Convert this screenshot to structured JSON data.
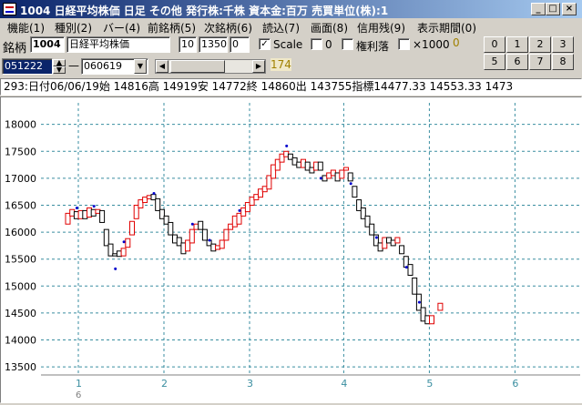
{
  "window": {
    "title": "1004 日経平均株価  日足  その他  発行株:千株  資本金:百万  売買単位(株):1",
    "min_label": "_",
    "max_label": "□",
    "close_label": "×"
  },
  "menu": [
    "機能(1)",
    "種別(2)",
    "バー(4)",
    "前銘柄(5)",
    "次銘柄(6)",
    "読込(7)",
    "画面(8)",
    "信用残(9)",
    "表示期間(0)"
  ],
  "toolbar": {
    "stock_label": "銘柄",
    "stock_code": "1004",
    "stock_name": "日経平均株価",
    "field_a": "10",
    "field_b": "1350",
    "field_c": "0",
    "scale_label": "Scale",
    "scale_checked": "✓",
    "check2_label": "0",
    "rights_label": "権利落",
    "x1000_label": "×1000",
    "x1000_value": "0",
    "numpad": [
      "0",
      "1",
      "2",
      "3",
      "5",
      "6",
      "7",
      "8"
    ]
  },
  "toolbar2": {
    "date_from": "051222",
    "dash": "—",
    "date_to": "060619",
    "count": "174"
  },
  "info": "293:日付06/06/19始 14816高 14919安 14772終 14860出 143755指標14477.33  14553.33  1473",
  "chart_data": {
    "type": "candlestick",
    "ylim": [
      13350,
      18400
    ],
    "yticks": [
      13500,
      14000,
      14500,
      15000,
      15500,
      16000,
      16500,
      17000,
      17500,
      18000
    ],
    "ytick_labels": [
      "13500",
      "14000",
      "14500",
      "15000",
      "15500",
      "16000",
      "16500",
      "17000",
      "17500",
      "18000"
    ],
    "month_labels": [
      "1",
      "2",
      "3",
      "4",
      "5",
      "6"
    ],
    "month_index": [
      0,
      20,
      40,
      62,
      82,
      102
    ],
    "year_label": "6",
    "colors": {
      "up": "#e00000",
      "down": "#000000",
      "dot": "#0000cc",
      "grid": "#3a8ea0"
    },
    "candles": [
      {
        "o": 16150,
        "c": 16350
      },
      {
        "o": 16300,
        "c": 16420
      },
      {
        "o": 16380,
        "c": 16250
      },
      {
        "o": 16250,
        "c": 16400
      },
      {
        "o": 16400,
        "c": 16250
      },
      {
        "o": 16280,
        "c": 16450
      },
      {
        "o": 16420,
        "c": 16300
      },
      {
        "o": 16350,
        "c": 16420
      },
      {
        "o": 16400,
        "c": 16180
      },
      {
        "o": 16050,
        "c": 15750
      },
      {
        "o": 15780,
        "c": 15560
      },
      {
        "o": 15600,
        "c": 15560
      },
      {
        "o": 15650,
        "c": 15550
      },
      {
        "o": 15560,
        "c": 15700
      },
      {
        "o": 15720,
        "c": 15880
      },
      {
        "o": 15950,
        "c": 16200
      },
      {
        "o": 16250,
        "c": 16500
      },
      {
        "o": 16450,
        "c": 16600
      },
      {
        "o": 16550,
        "c": 16650
      },
      {
        "o": 16620,
        "c": 16680
      },
      {
        "o": 16700,
        "c": 16600
      },
      {
        "o": 16620,
        "c": 16400
      },
      {
        "o": 16420,
        "c": 16250
      },
      {
        "o": 16300,
        "c": 16150
      },
      {
        "o": 16180,
        "c": 15950
      },
      {
        "o": 15950,
        "c": 15800
      },
      {
        "o": 15900,
        "c": 15750
      },
      {
        "o": 15800,
        "c": 15600
      },
      {
        "o": 15650,
        "c": 15850
      },
      {
        "o": 15800,
        "c": 16050
      },
      {
        "o": 16050,
        "c": 16150
      },
      {
        "o": 16200,
        "c": 16050
      },
      {
        "o": 16050,
        "c": 15850
      },
      {
        "o": 15850,
        "c": 15750
      },
      {
        "o": 15780,
        "c": 15650
      },
      {
        "o": 15680,
        "c": 15750
      },
      {
        "o": 15700,
        "c": 15850
      },
      {
        "o": 15850,
        "c": 16050
      },
      {
        "o": 16050,
        "c": 16150
      },
      {
        "o": 16100,
        "c": 16300
      },
      {
        "o": 16150,
        "c": 16350
      },
      {
        "o": 16300,
        "c": 16450
      },
      {
        "o": 16380,
        "c": 16550
      },
      {
        "o": 16500,
        "c": 16650
      },
      {
        "o": 16600,
        "c": 16700
      },
      {
        "o": 16650,
        "c": 16800
      },
      {
        "o": 16750,
        "c": 16850
      },
      {
        "o": 16800,
        "c": 17050
      },
      {
        "o": 17000,
        "c": 17250
      },
      {
        "o": 17150,
        "c": 17350
      },
      {
        "o": 17300,
        "c": 17450
      },
      {
        "o": 17400,
        "c": 17500
      },
      {
        "o": 17450,
        "c": 17350
      },
      {
        "o": 17380,
        "c": 17250
      },
      {
        "o": 17300,
        "c": 17200
      },
      {
        "o": 17200,
        "c": 17350
      },
      {
        "o": 17300,
        "c": 17150
      },
      {
        "o": 17200,
        "c": 17100
      },
      {
        "o": 17150,
        "c": 17300
      },
      {
        "o": 17300,
        "c": 17150
      },
      {
        "o": 17050,
        "c": 16950
      },
      {
        "o": 17000,
        "c": 17100
      },
      {
        "o": 17050,
        "c": 17150
      },
      {
        "o": 17100,
        "c": 16950
      },
      {
        "o": 17000,
        "c": 17150
      },
      {
        "o": 17150,
        "c": 17200
      },
      {
        "o": 17100,
        "c": 16950
      },
      {
        "o": 16850,
        "c": 16650
      },
      {
        "o": 16600,
        "c": 16400
      },
      {
        "o": 16450,
        "c": 16250
      },
      {
        "o": 16300,
        "c": 16100
      },
      {
        "o": 16150,
        "c": 15950
      },
      {
        "o": 15950,
        "c": 15750
      },
      {
        "o": 15800,
        "c": 15650
      },
      {
        "o": 15700,
        "c": 15900
      },
      {
        "o": 15900,
        "c": 15800
      },
      {
        "o": 15850,
        "c": 15750
      },
      {
        "o": 15800,
        "c": 15900
      },
      {
        "o": 15750,
        "c": 15600
      },
      {
        "o": 15550,
        "c": 15350
      },
      {
        "o": 15400,
        "c": 15200
      },
      {
        "o": 15150,
        "c": 14850
      },
      {
        "o": 14850,
        "c": 14550
      },
      {
        "o": 14600,
        "c": 14350
      },
      {
        "o": 14450,
        "c": 14300
      },
      {
        "o": 14300,
        "c": 14450
      }
    ],
    "extra_up": [
      {
        "o": 14550,
        "c": 14680
      }
    ],
    "dots": [
      {
        "i": 2,
        "v": 16450
      },
      {
        "i": 6,
        "v": 16480
      },
      {
        "i": 11,
        "v": 15320
      },
      {
        "i": 13,
        "v": 15820
      },
      {
        "i": 20,
        "v": 16720
      },
      {
        "i": 29,
        "v": 16150
      },
      {
        "i": 33,
        "v": 15850
      },
      {
        "i": 40,
        "v": 16400
      },
      {
        "i": 51,
        "v": 17600
      },
      {
        "i": 59,
        "v": 17000
      },
      {
        "i": 66,
        "v": 16900
      },
      {
        "i": 72,
        "v": 15900
      },
      {
        "i": 79,
        "v": 15350
      },
      {
        "i": 82,
        "v": 14700
      }
    ]
  }
}
